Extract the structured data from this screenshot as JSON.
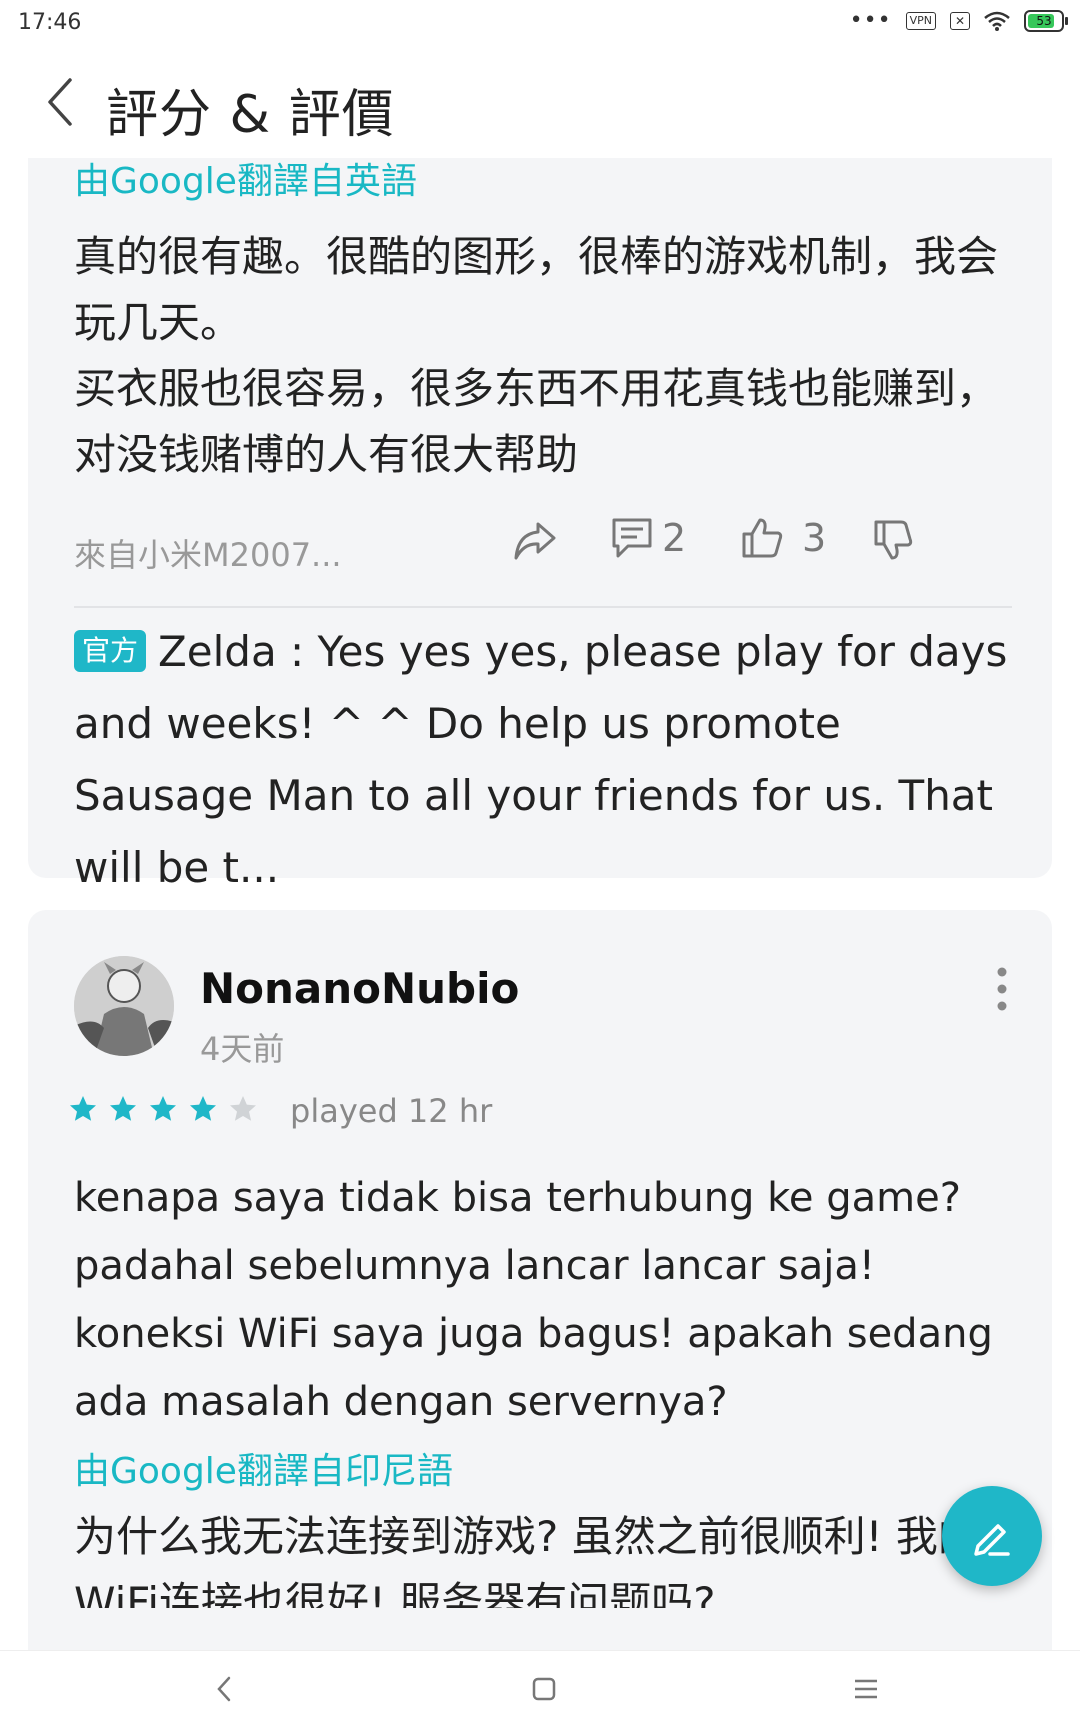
{
  "status_bar": {
    "time": "17:46",
    "dots": "•••",
    "vpn": "VPN",
    "sim": "✕",
    "battery": "53"
  },
  "header": {
    "title": "評分 & 評價"
  },
  "review1": {
    "translate_label": "由Google翻譯自英語",
    "translated_text": "真的很有趣。很酷的图形，很棒的游戏机制，我会玩几天。\n买衣服也很容易，很多东西不用花真钱也能赚到，对没钱赌博的人有很大帮助",
    "device": "來自小米M2007...",
    "comments_count": "2",
    "likes_count": "3",
    "official_reply": {
      "badge": "官方",
      "text": "Zelda : Yes yes yes, please play for days and weeks! ^ ^ Do help us promote Sausage Man to all your friends for us. That will be t..."
    }
  },
  "review2": {
    "username": "NonanoNubio",
    "posted": "4天前",
    "rating": 4,
    "rating_max": 5,
    "played": "played 12 hr",
    "text": "kenapa saya tidak bisa terhubung ke game? padahal sebelumnya lancar lancar saja! koneksi WiFi saya juga bagus! apakah sedang ada masalah dengan servernya?",
    "translate_label": "由Google翻譯自印尼語",
    "translated_text": "为什么我无法连接到游戏? 虽然之前很顺利! 我的WiFi连接也很好! 服务器有问题吗?"
  },
  "colors": {
    "accent": "#1fb7c8",
    "star_filled": "#1fb7c8",
    "star_empty": "#d0d3d6",
    "card_bg": "#f4f5f7"
  },
  "icons": {
    "back": "chevron-left-icon",
    "share": "share-arrow-icon",
    "comment": "comment-icon",
    "like": "thumbs-up-icon",
    "dislike": "thumbs-down-icon",
    "more": "more-vertical-icon",
    "fab": "edit-pen-icon"
  }
}
